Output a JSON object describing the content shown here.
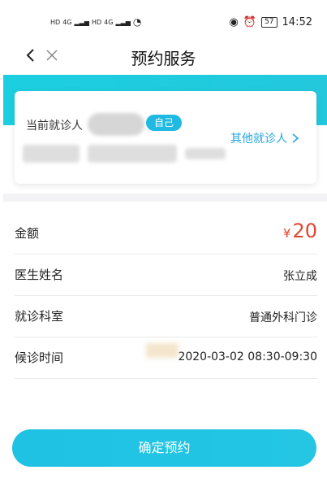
{
  "status_bar": {
    "hd_label_1": "HD",
    "hd_label_2": "HD",
    "net_4g_1": "4G",
    "net_4g_2": "4G",
    "battery": "57",
    "time": "14:52"
  },
  "nav": {
    "title": "预约服务"
  },
  "patient": {
    "label": "当前就诊人",
    "self_badge": "自己",
    "other_patient_label": "其他就诊人"
  },
  "details": [
    {
      "label": "金额",
      "currency": "¥",
      "amount": "20"
    },
    {
      "label": "医生姓名",
      "value": "张立成"
    },
    {
      "label": "就诊科室",
      "value": "普通外科门诊"
    },
    {
      "label": "候诊时间",
      "value": "2020-03-02 08:30-09:30"
    }
  ],
  "actions": {
    "confirm_label": "确定预约"
  },
  "colors": {
    "accent": "#1fc2e3",
    "price": "#e2452f",
    "link": "#21a7df"
  }
}
